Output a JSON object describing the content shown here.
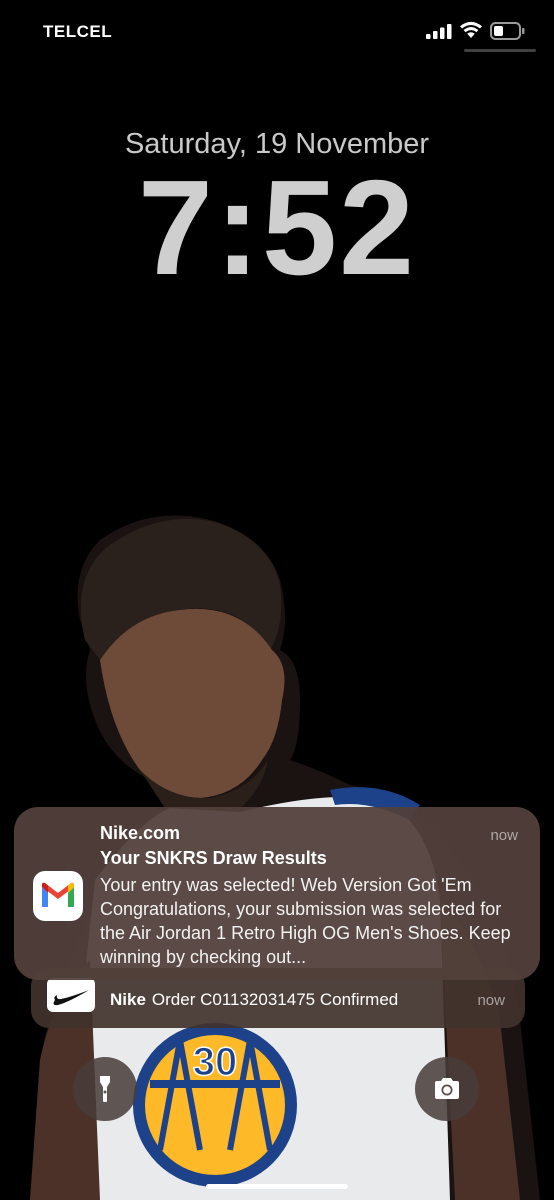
{
  "status_bar": {
    "carrier": "TELCEL"
  },
  "lock_screen": {
    "date": "Saturday, 19 November",
    "time": "7:52"
  },
  "notifications": [
    {
      "app": "Nike.com",
      "time": "now",
      "title": "Your SNKRS Draw Results",
      "body": "Your entry was selected! Web Version Got 'Em Congratulations, your submission was selected for the Air Jordan 1 Retro High OG Men's Shoes. Keep winning by checking out...",
      "icon": "gmail-icon"
    },
    {
      "app": "Nike",
      "time": "now",
      "title": "Order C01132031475 Confirmed",
      "icon": "nike-swoosh-icon"
    }
  ],
  "wallpaper": {
    "jersey_number": "30"
  },
  "quick_actions": {
    "left": "flashlight-icon",
    "right": "camera-icon"
  }
}
